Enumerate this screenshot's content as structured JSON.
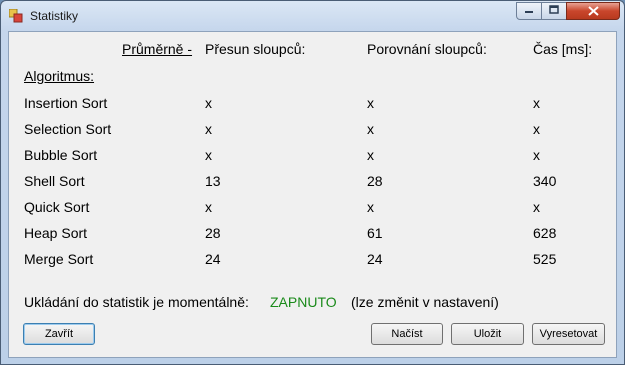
{
  "window": {
    "title": "Statistiky"
  },
  "header": {
    "average": "Průměrně -",
    "col_moves": "Přesun sloupců:",
    "col_compares": "Porovnání sloupců:",
    "col_time": "Čas [ms]:",
    "algorithm": "Algoritmus:"
  },
  "rows": [
    {
      "name": "Insertion Sort",
      "moves": "x",
      "compares": "x",
      "time": "x"
    },
    {
      "name": "Selection Sort",
      "moves": "x",
      "compares": "x",
      "time": "x"
    },
    {
      "name": "Bubble Sort",
      "moves": "x",
      "compares": "x",
      "time": "x"
    },
    {
      "name": "Shell Sort",
      "moves": "13",
      "compares": "28",
      "time": "340"
    },
    {
      "name": "Quick Sort",
      "moves": "x",
      "compares": "x",
      "time": "x"
    },
    {
      "name": "Heap Sort",
      "moves": "28",
      "compares": "61",
      "time": "628"
    },
    {
      "name": "Merge Sort",
      "moves": "24",
      "compares": "24",
      "time": "525"
    }
  ],
  "status": {
    "prefix": "Ukládání do statistik je momentálně:",
    "value": "ZAPNUTO",
    "note": "(lze změnit v nastavení)",
    "value_color": "#1a8a1a"
  },
  "buttons": {
    "close": "Zavřít",
    "load": "Načíst",
    "save": "Uložit",
    "reset": "Vyresetovat"
  }
}
